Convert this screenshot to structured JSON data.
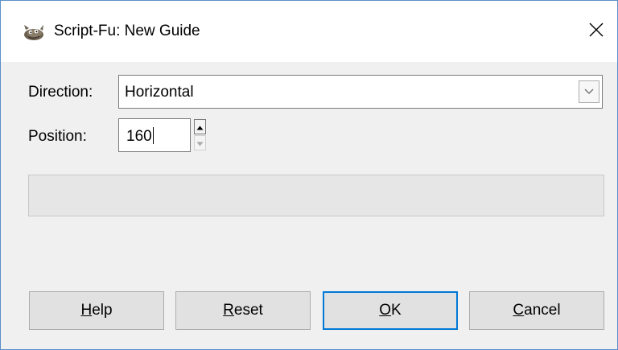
{
  "window": {
    "title": "Script-Fu: New Guide",
    "app_icon": "gimp-wilber-icon",
    "close_icon": "close-icon"
  },
  "form": {
    "direction_label": "Direction:",
    "direction_value": "Horizontal",
    "position_label": "Position:",
    "position_value": "160"
  },
  "progress": {
    "value": 0
  },
  "buttons": {
    "help": {
      "mnemonic": "H",
      "rest": "elp"
    },
    "reset": {
      "mnemonic": "R",
      "rest": "eset"
    },
    "ok": {
      "mnemonic": "O",
      "rest": "K"
    },
    "cancel": {
      "mnemonic": "C",
      "rest": "ancel"
    }
  },
  "colors": {
    "accent": "#0078d7",
    "window_border": "#5b8fc9",
    "dialog_bg": "#f0f0f0"
  }
}
